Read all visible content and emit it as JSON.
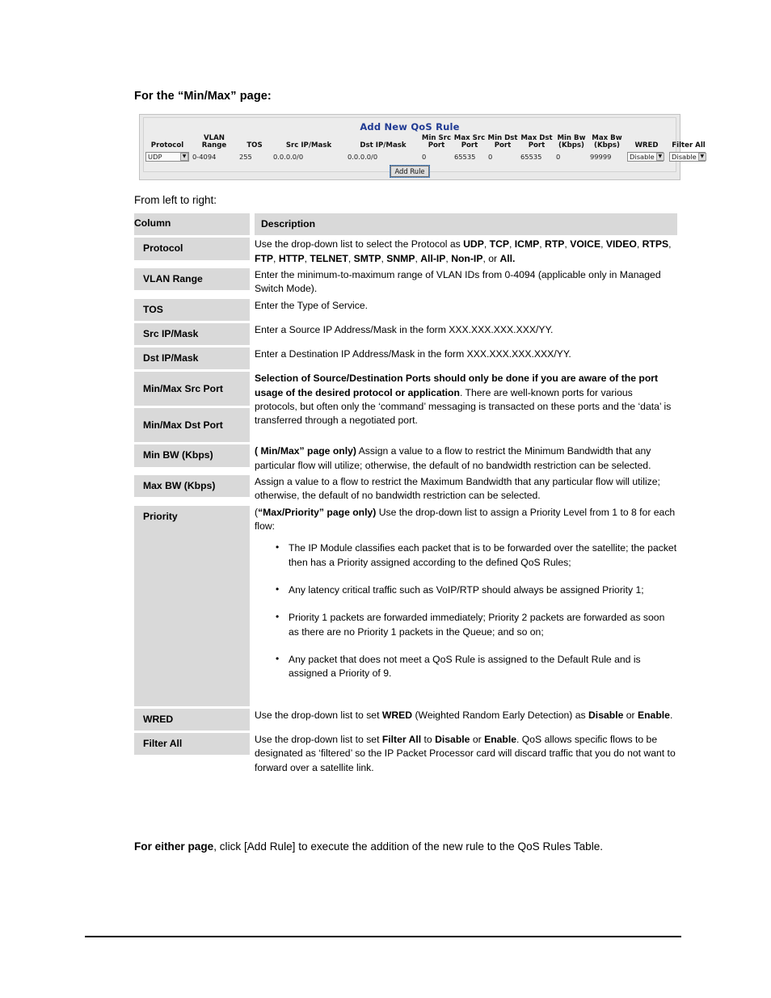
{
  "heading": "For the “Min/Max” page:",
  "intro": "From left to right:",
  "screenshot": {
    "title": "Add New QoS Rule",
    "columns": [
      "Protocol",
      "VLAN Range",
      "TOS",
      "Src IP/Mask",
      "Dst IP/Mask",
      "Min Src\nPort",
      "Max Src\nPort",
      "Min Dst\nPort",
      "Max Dst\nPort",
      "Min Bw\n(Kbps)",
      "Max Bw\n(Kbps)",
      "WRED",
      "Filter All"
    ],
    "values": {
      "protocol": "UDP",
      "vlan_range": "0-4094",
      "tos": "255",
      "src_ip_mask": "0.0.0.0/0",
      "dst_ip_mask": "0.0.0.0/0",
      "min_src_port": "0",
      "max_src_port": "65535",
      "min_dst_port": "0",
      "max_dst_port": "65535",
      "min_bw": "0",
      "max_bw": "99999",
      "wred": "Disable",
      "filter_all": "Disable"
    },
    "add_rule_button": "Add Rule",
    "dropdown_arrow": "▼",
    "title_color": "#1f3a93",
    "panel_color": "#ececec"
  },
  "table": {
    "header": {
      "column": "Column",
      "description": "Description"
    },
    "rows": [
      {
        "term": "Protocol",
        "desc_html": "Use the drop-down list to select the Protocol as <b>UDP</b>, <b>TCP</b>, <b>ICMP</b>, <b>RTP</b>, <b>VOICE</b>, <b>VIDEO</b>, <b>RTPS</b>, <b>FTP</b>, <b>HTTP</b>, <b>TELNET</b>, <b>SMTP</b>, <b>SNMP</b>, <b>All-IP</b>, <b>Non-IP</b>, or <b>All.</b>"
      },
      {
        "term": "VLAN Range",
        "desc_html": "Enter the minimum-to-maximum range of VLAN IDs from 0-4094 (applicable only in Managed Switch Mode)."
      },
      {
        "term": "TOS",
        "desc_html": "Enter the Type of Service."
      },
      {
        "term": "Src IP/Mask",
        "desc_html": "Enter a Source IP Address/Mask in the form XXX.XXX.XXX.XXX/YY."
      },
      {
        "term": "Dst IP/Mask",
        "desc_html": "Enter a Destination IP Address/Mask in the form XXX.XXX.XXX.XXX/YY."
      },
      {
        "term": "Min/Max Src Port",
        "term2": "Min/Max Dst Port",
        "desc_html": "<b>Selection of Source/Destination Ports should only be done if you are aware of the port usage of the desired protocol or application</b>. There are well-known ports for various protocols, but often only the ‘command’ messaging is transacted on these ports and the ‘data’ is transferred through a negotiated port."
      },
      {
        "term": "Min BW (Kbps)",
        "desc_html": "<b>( Min/Max” page only)</b> Assign a value to a flow to restrict the Minimum Bandwidth that any particular flow will utilize; otherwise, the default of no bandwidth restriction can be selected."
      },
      {
        "term": "Max BW (Kbps)",
        "desc_html": "Assign a value to a flow to restrict the Maximum Bandwidth that any particular flow will utilize; otherwise, the default of no bandwidth restriction can be selected."
      },
      {
        "term": "Priority",
        "desc_html": "(<b>“Max/Priority” page only)</b> Use the drop-down list to assign a Priority Level from 1 to 8 for each flow:",
        "bullets": [
          "The IP Module classifies each packet that is to be forwarded over the satellite; the packet then has a Priority assigned according to the defined QoS Rules;",
          "Any latency critical traffic such as VoIP/RTP should always be assigned Priority 1;",
          "Priority 1 packets are forwarded immediately; Priority 2 packets are forwarded as soon as there are no Priority 1 packets in the Queue; and so on;",
          "Any packet that does not meet a QoS Rule is assigned to the Default Rule and is assigned a Priority of 9."
        ]
      },
      {
        "term": "WRED",
        "desc_html": "Use the drop-down list to set <b>WRED</b> (Weighted Random Early Detection) as <b>Disable</b> or <b>Enable</b>."
      },
      {
        "term": "Filter All",
        "desc_html": "Use the drop-down list to set <b>Filter All</b> to <b>Disable</b> or <b>Enable</b>. QoS allows specific flows to be designated as ‘filtered’ so the IP Packet Processor card will discard traffic that you do not want to forward over a satellite link."
      }
    ]
  },
  "closing_html": "<b>For either page</b>, click [Add Rule] to execute the addition of the new rule to the QoS Rules Table."
}
